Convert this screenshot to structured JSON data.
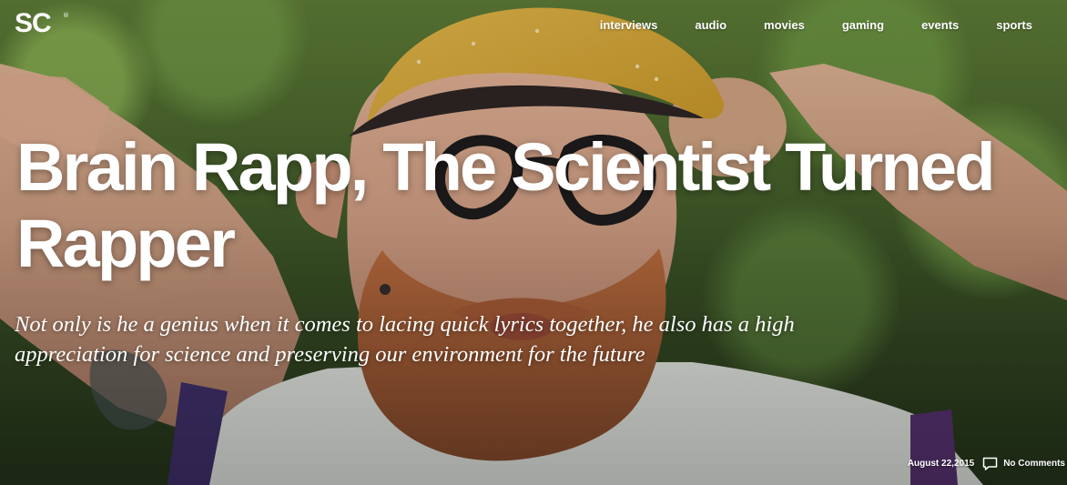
{
  "site": {
    "logo": "SC",
    "logo_mark": "®"
  },
  "nav": {
    "items": [
      "interviews",
      "audio",
      "movies",
      "gaming",
      "events",
      "sports"
    ]
  },
  "article": {
    "title": "Brain Rapp, The Scientist Turned Rapper",
    "subtitle": "Not only is he a genius when it comes to lacing quick lyrics together, he also has a high appreciation for science and preserving our environment for the future",
    "date": "August 22,2015",
    "comments": "No Comments"
  },
  "icons": {
    "comments": "comment-icon"
  },
  "colors": {
    "text": "#ffffff",
    "foliage": "#5c7a35",
    "cap": "#d2a637",
    "beard": "#a85f37",
    "shirt": "#e9ece7",
    "skin": "#c9987b"
  }
}
